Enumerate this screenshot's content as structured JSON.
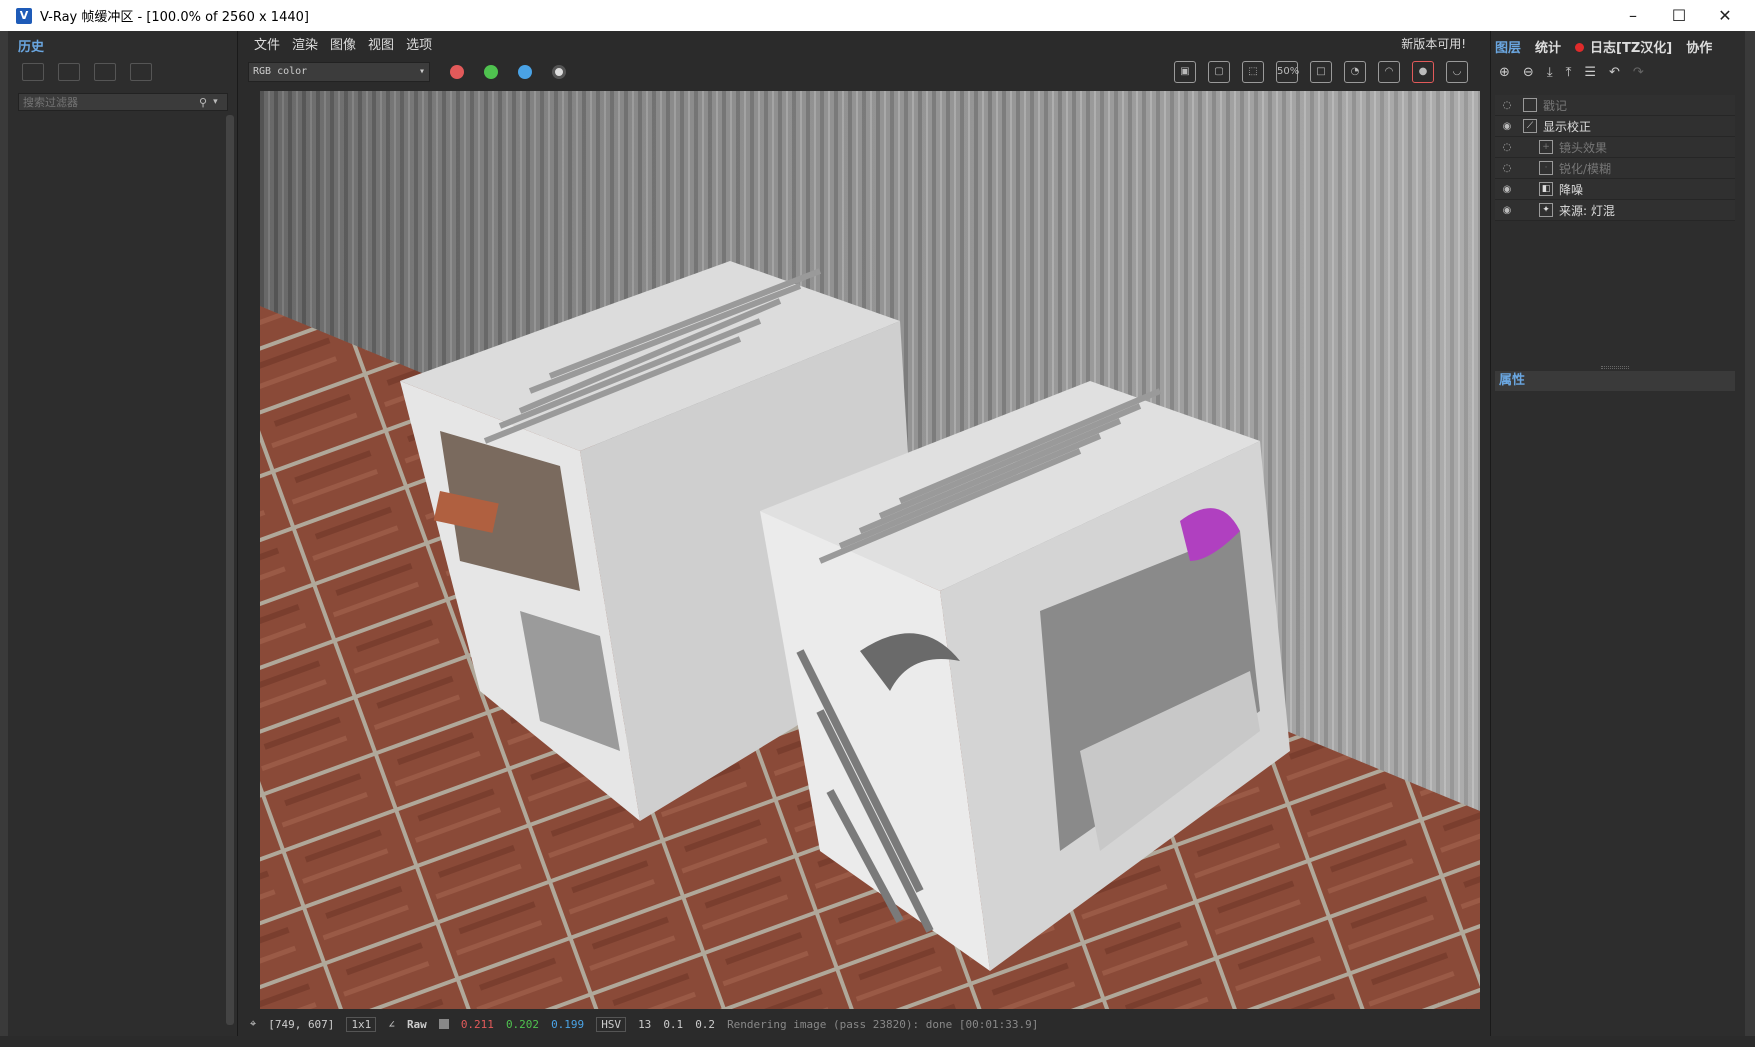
{
  "window": {
    "title": "V-Ray 帧缓冲区 - [100.0% of 2560 x 1440]",
    "minimize": "–",
    "maximize": "☐",
    "close": "✕"
  },
  "history": {
    "tab": "历史",
    "search_placeholder": "搜索过滤器"
  },
  "menu": {
    "items": [
      "文件",
      "渲染",
      "图像",
      "视图",
      "选项"
    ],
    "update_note": "新版本可用!"
  },
  "toolbar": {
    "channel": "RGB color",
    "colors": {
      "red": "#e25a5a",
      "green": "#4fc24f",
      "blue": "#4aa3e6"
    },
    "zoom_label": "50%"
  },
  "status": {
    "coords": "[749, 607]",
    "sampler": "1x1",
    "raw_label": "Raw",
    "r": "0.211",
    "g": "0.202",
    "b": "0.199",
    "color_mode": "HSV",
    "h": "13",
    "s": "0.1",
    "v": "0.2",
    "message": "Rendering image (pass 23820): done [00:01:33.9]"
  },
  "right": {
    "tabs": [
      "图层",
      "统计",
      "日志[TZ汉化]",
      "协作"
    ],
    "layers": [
      {
        "label": "戳记",
        "visible": false,
        "indent": false
      },
      {
        "label": "显示校正",
        "visible": true,
        "indent": false
      },
      {
        "label": "镜头效果",
        "visible": false,
        "indent": true
      },
      {
        "label": "锐化/模糊",
        "visible": false,
        "indent": true
      },
      {
        "label": "降噪",
        "visible": true,
        "indent": true
      },
      {
        "label": "来源: 灯混",
        "visible": true,
        "indent": true
      }
    ],
    "properties": "属性"
  }
}
